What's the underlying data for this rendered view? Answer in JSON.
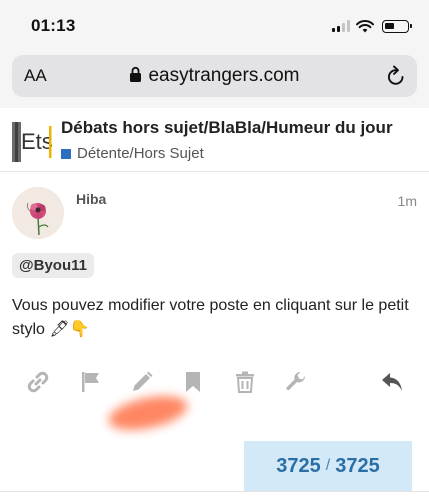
{
  "status_bar": {
    "time": "01:13"
  },
  "browser": {
    "text_size_label": "AA",
    "url": "easytrangers.com"
  },
  "topic": {
    "title": "Débats hors sujet/BlaBla/Humeur du jour",
    "category": "Détente/Hors Sujet",
    "category_color": "#2c6fc0",
    "logo_text": "Ets"
  },
  "post": {
    "author": "Hiba",
    "time": "1m",
    "mention": "@Byou11",
    "body": "Vous pouvez modifier votre poste en cliquant sur le petit stylo 🖋👇"
  },
  "actions": {
    "icons": [
      "link-icon",
      "flag-icon",
      "pencil-icon",
      "bookmark-icon",
      "trash-icon",
      "wrench-icon",
      "reply-icon"
    ]
  },
  "progress": {
    "current": "3725",
    "separator": "/",
    "total": "3725"
  },
  "colors": {
    "accent": "#2a6ea6",
    "progress_bg": "#d3e9f7",
    "icon_gray": "#b5b5b5"
  }
}
